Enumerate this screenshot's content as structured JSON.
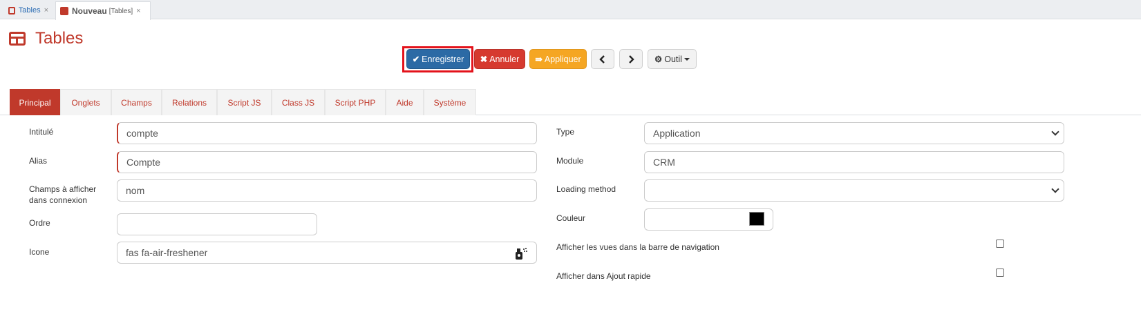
{
  "doc_tabs": [
    {
      "label": "Tables",
      "close": "×"
    },
    {
      "label": "Nouveau",
      "sub": "[Tables]",
      "close": "×"
    }
  ],
  "page": {
    "title": "Tables"
  },
  "toolbar": {
    "save_label": "Enregistrer",
    "cancel_label": "Annuler",
    "apply_label": "Appliquer",
    "tool_label": "Outil",
    "save_icon": "check-icon",
    "cancel_icon": "times-icon",
    "apply_icon": "apply-icon",
    "prev_icon": "chevron-left-icon",
    "next_icon": "chevron-right-icon",
    "tool_icon": "gear-icon"
  },
  "section_tabs": [
    "Principal",
    "Onglets",
    "Champs",
    "Relations",
    "Script JS",
    "Class JS",
    "Script PHP",
    "Aide",
    "Système"
  ],
  "form_left": {
    "intitule_label": "Intitulé",
    "intitule_value": "compte",
    "alias_label": "Alias",
    "alias_value": "Compte",
    "champs_label_1": "Champs à afficher",
    "champs_label_2": "dans connexion",
    "champs_value": "nom",
    "ordre_label": "Ordre",
    "ordre_value": "",
    "icone_label": "Icone",
    "icone_value": "fas fa-air-freshener"
  },
  "form_right": {
    "type_label": "Type",
    "type_value": "Application",
    "module_label": "Module",
    "module_value": "CRM",
    "loading_label": "Loading method",
    "loading_value": "",
    "couleur_label": "Couleur",
    "couleur_value": "#000000",
    "afficher_vues_label": "Afficher les vues dans la barre de navigation",
    "afficher_vues_checked": false,
    "ajout_rapide_label": "Afficher dans Ajout rapide",
    "ajout_rapide_checked": false
  },
  "colors": {
    "accent": "#c0392b",
    "primary": "#2c6aa5",
    "danger": "#d63a2f",
    "warning": "#f5a623",
    "highlight": "#e3121b"
  }
}
